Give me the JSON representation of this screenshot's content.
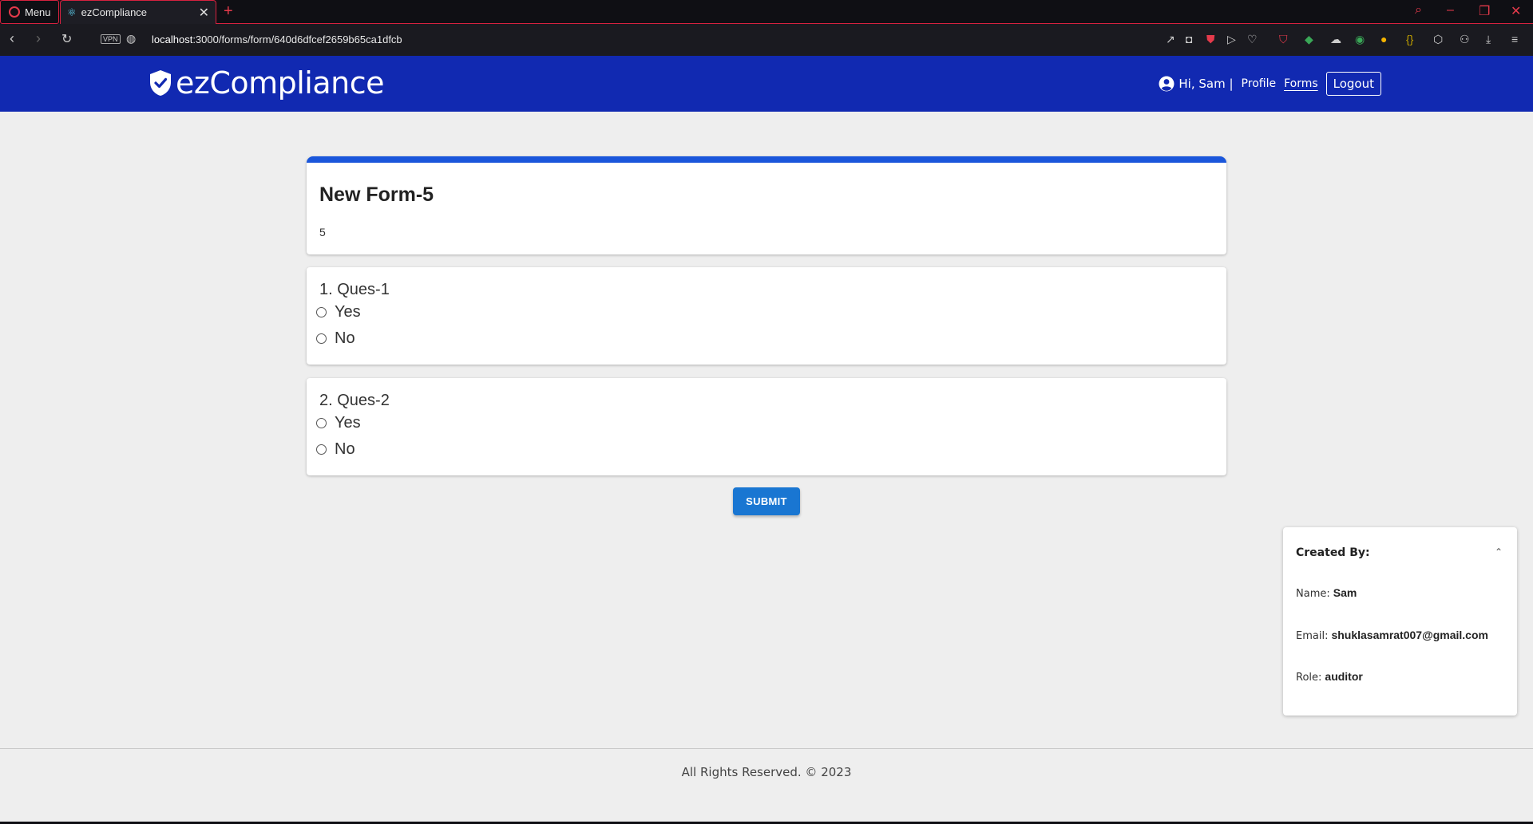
{
  "browser": {
    "menu_label": "Menu",
    "tab_title": "ezCompliance",
    "url_host": "localhost",
    "url_path": ":3000/forms/form/640d6dfcef2659b65ca1dfcb",
    "vpn_label": "VPN"
  },
  "header": {
    "brand": "ezCompliance",
    "greeting": "Hi, Sam |",
    "nav": {
      "profile": "Profile",
      "forms": "Forms",
      "logout": "Logout"
    },
    "colors": {
      "background": "#1129b1"
    }
  },
  "form": {
    "title": "New Form-5",
    "description": "5",
    "accent_color": "#1a56db",
    "questions": [
      {
        "label": "1. Ques-1",
        "options": [
          "Yes",
          "No"
        ]
      },
      {
        "label": "2. Ques-2",
        "options": [
          "Yes",
          "No"
        ]
      }
    ],
    "submit_label": "SUBMIT"
  },
  "creator": {
    "heading": "Created By:",
    "name_label": "Name:",
    "name": "Sam",
    "email_label": "Email:",
    "email": "shuklasamrat007@gmail.com",
    "role_label": "Role:",
    "role": "auditor"
  },
  "footer": {
    "text": "All Rights Reserved. © 2023"
  }
}
